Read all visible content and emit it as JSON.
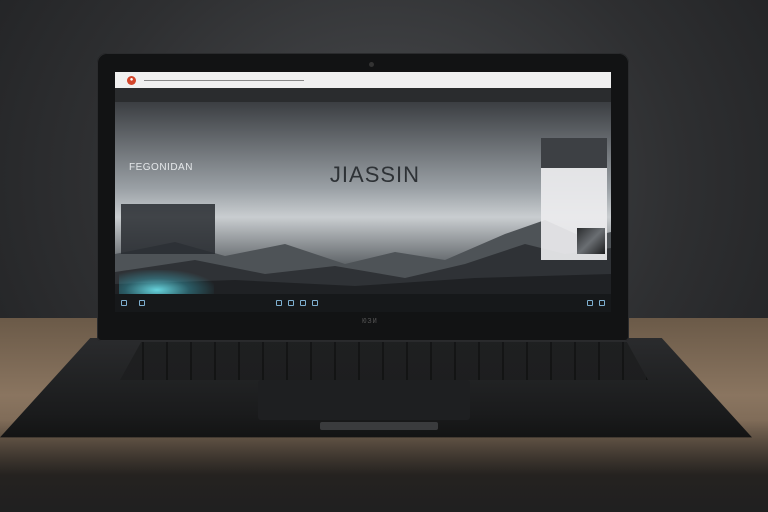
{
  "browser": {
    "url_text": "",
    "right_text": ""
  },
  "navbar": {
    "items": [
      "",
      "",
      "",
      "",
      "",
      "",
      ""
    ]
  },
  "hero": {
    "title": "JIASSIN",
    "subtitle": ""
  },
  "left_panel": {
    "heading": "FEGONIDAN",
    "subheading": "",
    "box_lines": [
      "",
      "",
      ""
    ]
  },
  "right_panel": {
    "title": "",
    "subtitle": "",
    "lines": [
      "",
      "",
      "",
      "",
      "",
      ""
    ]
  },
  "taskbar": {
    "items": [
      "",
      "",
      ""
    ]
  },
  "bezel": {
    "logo": "ЮЗИ"
  },
  "colors": {
    "accent_glow": "#6ee6f0",
    "brand_icon": "#d3452b",
    "taskbar_text": "#9fc7e0"
  }
}
